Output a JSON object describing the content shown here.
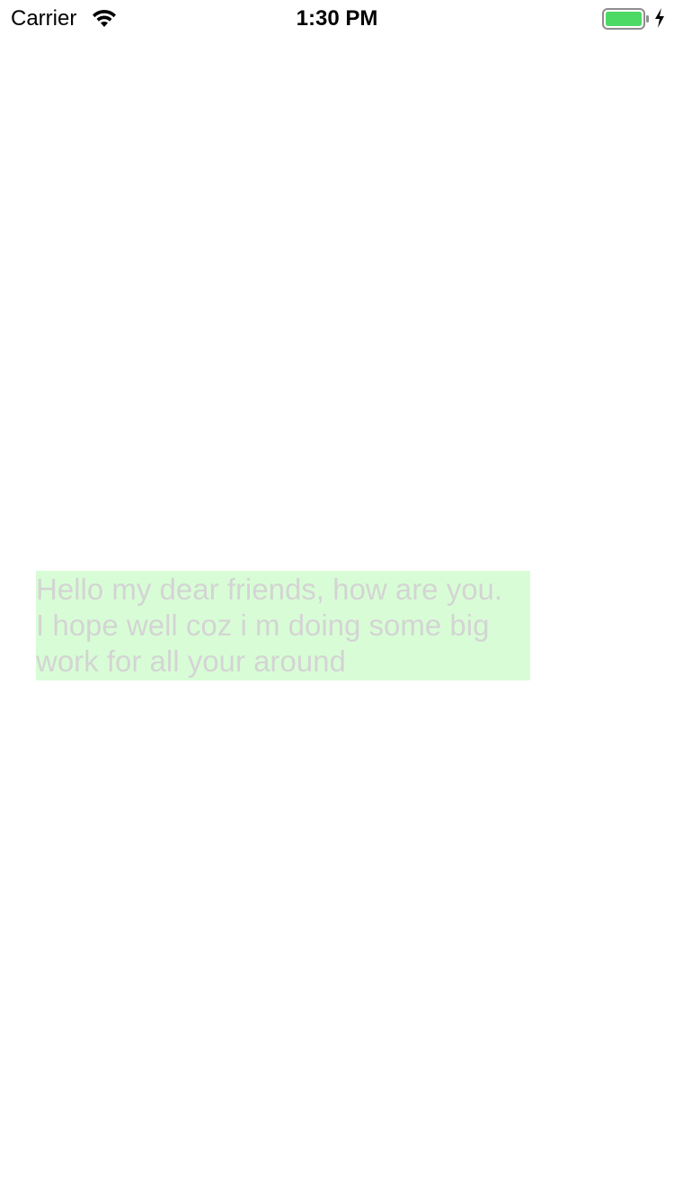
{
  "status_bar": {
    "carrier": "Carrier",
    "time": "1:30 PM",
    "battery_color": "#4cd964",
    "icons": [
      "wifi-icon",
      "battery-icon",
      "charging-icon"
    ]
  },
  "message": {
    "text": "Hello my dear friends, how are you.\nI hope well coz i m doing some big\nwork for all your around",
    "background_color": "#d8fdd6",
    "text_color": "#d4d4d4"
  }
}
